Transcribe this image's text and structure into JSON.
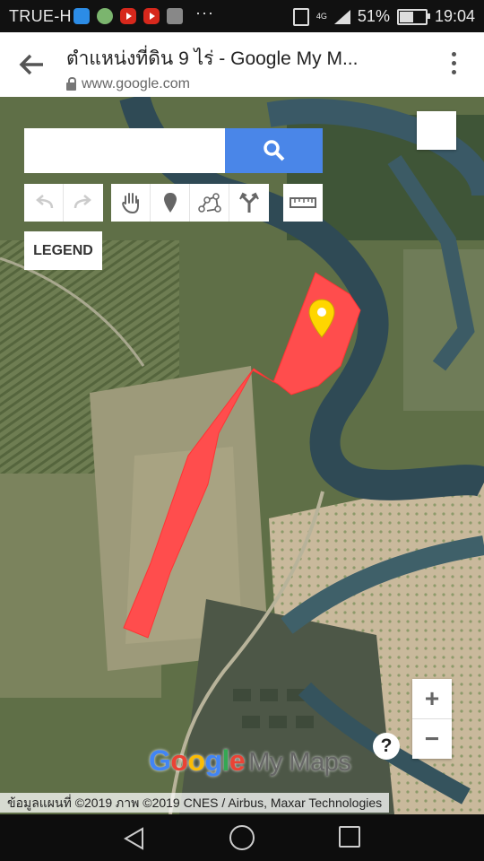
{
  "status_bar": {
    "carrier": "TRUE-H",
    "more": "···",
    "network": "4G",
    "battery_level": "51%",
    "battery_fraction": 0.51,
    "time": "19:04",
    "icons": [
      "messenger-icon",
      "app-icon",
      "youtube-icon",
      "youtube-icon",
      "gallery-icon"
    ]
  },
  "browser": {
    "title": "ตำแหน่งที่ดิน 9 ไร่ - Google My M...",
    "url": "www.google.com"
  },
  "map": {
    "search": {
      "value": "",
      "placeholder": ""
    },
    "toolbar": {
      "undo": "undo-icon",
      "redo": "redo-icon",
      "pan": "hand-icon",
      "marker": "marker-icon",
      "line": "draw-line-icon",
      "directions": "directions-icon",
      "measure": "ruler-icon"
    },
    "legend_label": "LEGEND",
    "zoom_in": "+",
    "zoom_out": "−",
    "help": "?",
    "brand_google": [
      "G",
      "o",
      "o",
      "g",
      "l",
      "e"
    ],
    "brand_mymaps": "My Maps",
    "attribution": "ข้อมูลแผนที่ ©2019 ภาพ ©2019 CNES / Airbus, Maxar Technologies",
    "colors": {
      "polygon": "#ff4d4d",
      "marker": "#ffd600",
      "search_button": "#4a86e8"
    }
  }
}
